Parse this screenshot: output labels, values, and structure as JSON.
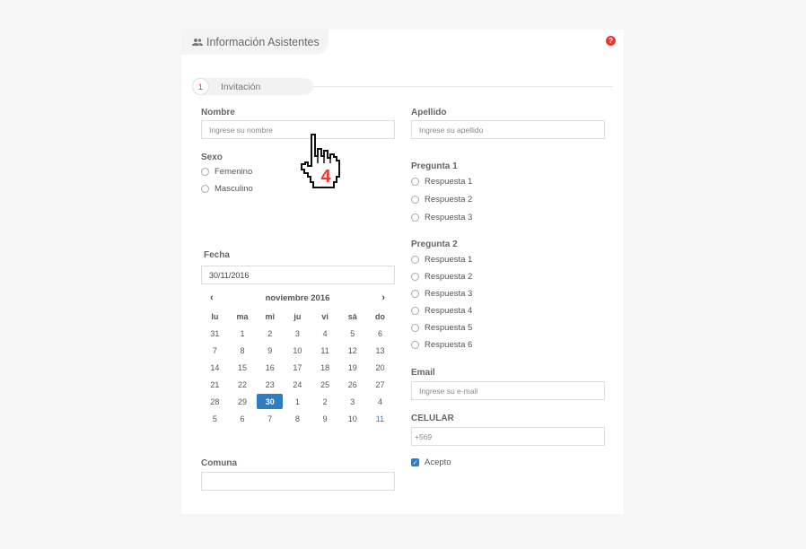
{
  "header": {
    "title": "Información Asistentes",
    "help": "?"
  },
  "step": {
    "number": "1",
    "label": "Invitación"
  },
  "form": {
    "nombre": {
      "label": "Nombre",
      "placeholder": "Ingrese su nombre"
    },
    "apellido": {
      "label": "Apellido",
      "placeholder": "Ingrese su apellido"
    },
    "sexo": {
      "label": "Sexo",
      "options": [
        "Femenino",
        "Masculino"
      ]
    },
    "pregunta1": {
      "label": "Pregunta 1",
      "options": [
        "Respuesta 1",
        "Respuesta 2",
        "Respuesta 3"
      ]
    },
    "pregunta2": {
      "label": "Pregunta 2",
      "options": [
        "Respuesta 1",
        "Respuesta 2",
        "Respuesta 3",
        "Respuesta 4",
        "Respuesta 5",
        "Respuesta 6"
      ]
    },
    "fecha": {
      "label": "Fecha",
      "value": "30/11/2016"
    },
    "email": {
      "label": "Email",
      "placeholder": "Ingrese su e-mail"
    },
    "celular": {
      "label": "CELULAR",
      "placeholder": "+569"
    },
    "acepto": {
      "label": "Acepto",
      "checked": true
    },
    "comuna": {
      "label": "Comuna",
      "value": ""
    }
  },
  "calendar": {
    "month": "noviembre 2016",
    "prev": "‹",
    "next": "›",
    "weekdays": [
      "lu",
      "ma",
      "mi",
      "ju",
      "vi",
      "sá",
      "do"
    ],
    "weeks": [
      [
        "31",
        "1",
        "2",
        "3",
        "4",
        "5",
        "6"
      ],
      [
        "7",
        "8",
        "9",
        "10",
        "11",
        "12",
        "13"
      ],
      [
        "14",
        "15",
        "16",
        "17",
        "18",
        "19",
        "20"
      ],
      [
        "21",
        "22",
        "23",
        "24",
        "25",
        "26",
        "27"
      ],
      [
        "28",
        "29",
        "30",
        "1",
        "2",
        "3",
        "4"
      ],
      [
        "5",
        "6",
        "7",
        "8",
        "9",
        "10",
        "11"
      ]
    ],
    "selected": "30",
    "accent": "#2f7dc0"
  },
  "cursor": {
    "badge": "4",
    "icon": "hand-pointer-icon"
  },
  "colors": {
    "accent": "#2f7dc0",
    "danger": "#e53935"
  }
}
